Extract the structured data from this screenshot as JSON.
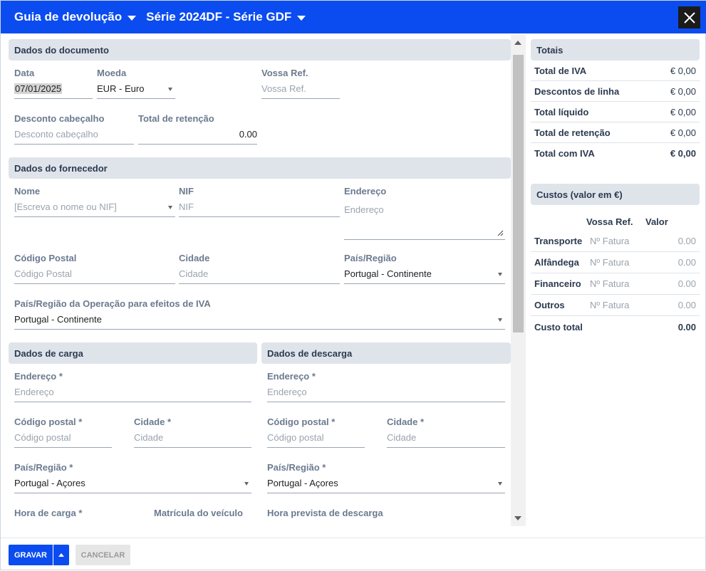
{
  "window": {
    "title": "Guia de devolução",
    "series_label": "Série",
    "series_value": "2024DF - Série GDF"
  },
  "document": {
    "header": "Dados do documento",
    "date_label": "Data",
    "date_value": "07/01/2025",
    "currency_label": "Moeda",
    "currency_value": "EUR - Euro",
    "your_ref_label": "Vossa Ref.",
    "your_ref_placeholder": "Vossa Ref.",
    "header_discount_label": "Desconto cabeçalho",
    "header_discount_placeholder": "Desconto cabeçalho",
    "withholding_label": "Total de retenção",
    "withholding_value": "0.00"
  },
  "supplier": {
    "header": "Dados do fornecedor",
    "name_label": "Nome",
    "name_placeholder": "[Escreva o nome ou NIF]",
    "nif_label": "NIF",
    "nif_placeholder": "NIF",
    "address_label": "Endereço",
    "address_placeholder": "Endereço",
    "postal_label": "Código Postal",
    "postal_placeholder": "Código Postal",
    "city_label": "Cidade",
    "city_placeholder": "Cidade",
    "country_label": "País/Região",
    "country_value": "Portugal - Continente",
    "vat_country_label": "País/Região da Operação para efeitos de IVA",
    "vat_country_value": "Portugal - Continente"
  },
  "loading": {
    "header": "Dados de carga",
    "address_label": "Endereço *",
    "address_placeholder": "Endereço",
    "postal_label": "Código postal *",
    "postal_placeholder": "Código postal",
    "city_label": "Cidade *",
    "city_placeholder": "Cidade",
    "country_label": "País/Região *",
    "country_value": "Portugal - Açores",
    "time_label": "Hora de carga *",
    "plate_label": "Matrícula do veículo"
  },
  "unloading": {
    "header": "Dados de descarga",
    "address_label": "Endereço *",
    "address_placeholder": "Endereço",
    "postal_label": "Código postal *",
    "postal_placeholder": "Código postal",
    "city_label": "Cidade *",
    "city_placeholder": "Cidade",
    "country_label": "País/Região *",
    "country_value": "Portugal - Açores",
    "time_label": "Hora prevista de descarga"
  },
  "totals": {
    "header": "Totais",
    "rows": [
      {
        "label": "Total de IVA",
        "value": "€ 0,00"
      },
      {
        "label": "Descontos de linha",
        "value": "€ 0,00"
      },
      {
        "label": "Total líquido",
        "value": "€ 0,00"
      },
      {
        "label": "Total de retenção",
        "value": "€ 0,00"
      },
      {
        "label": "Total com IVA",
        "value": "€ 0,00"
      }
    ]
  },
  "costs": {
    "header": "Custos (valor em €)",
    "col_ref": "Vossa Ref.",
    "col_value": "Valor",
    "rows": [
      {
        "label": "Transporte",
        "ref_placeholder": "Nº Fatura",
        "value": "0.00"
      },
      {
        "label": "Alfândega",
        "ref_placeholder": "Nº Fatura",
        "value": "0.00"
      },
      {
        "label": "Financeiro",
        "ref_placeholder": "Nº Fatura",
        "value": "0.00"
      },
      {
        "label": "Outros",
        "ref_placeholder": "Nº Fatura",
        "value": "0.00"
      }
    ],
    "total_label": "Custo total",
    "total_value": "0.00"
  },
  "footer": {
    "save_label": "GRAVAR",
    "cancel_label": "CANCELAR"
  },
  "colors": {
    "primary": "#0b4cf0",
    "section_bg": "#dfe4eb",
    "label": "#6b7a8f"
  }
}
